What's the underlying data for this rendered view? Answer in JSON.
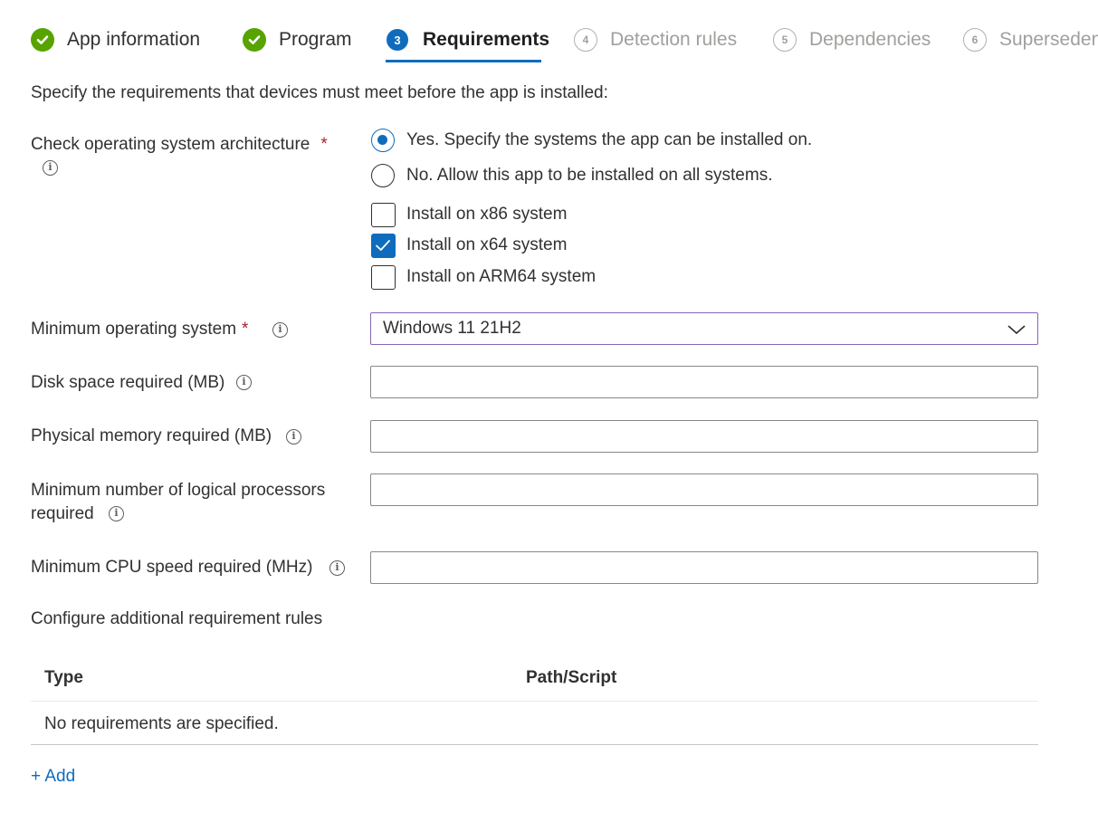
{
  "steps": [
    {
      "number": "",
      "label": "App information",
      "state": "done"
    },
    {
      "number": "",
      "label": "Program",
      "state": "done"
    },
    {
      "number": "3",
      "label": "Requirements",
      "state": "current"
    },
    {
      "number": "4",
      "label": "Detection rules",
      "state": "pending"
    },
    {
      "number": "5",
      "label": "Dependencies",
      "state": "pending"
    },
    {
      "number": "6",
      "label": "Superseden",
      "state": "pending"
    }
  ],
  "intro": "Specify the requirements that devices must meet before the app is installed:",
  "arch": {
    "label": "Check operating system architecture",
    "required_mark": "*",
    "options": [
      {
        "label": "Yes. Specify the systems the app can be installed on.",
        "selected": true
      },
      {
        "label": "No. Allow this app to be installed on all systems.",
        "selected": false
      }
    ],
    "systems": [
      {
        "label": "Install on x86 system",
        "checked": false
      },
      {
        "label": "Install on x64 system",
        "checked": true
      },
      {
        "label": "Install on ARM64 system",
        "checked": false
      }
    ]
  },
  "fields": {
    "min_os": {
      "label": "Minimum operating system",
      "required_mark": "*",
      "value": "Windows 11 21H2"
    },
    "disk": {
      "label": "Disk space required (MB)",
      "value": ""
    },
    "memory": {
      "label": "Physical memory required (MB)",
      "value": ""
    },
    "processors": {
      "label_line1": "Minimum number of logical processors",
      "label_line2": "required",
      "value": ""
    },
    "cpu": {
      "label": "Minimum CPU speed required (MHz)",
      "value": ""
    }
  },
  "additional": {
    "title": "Configure additional requirement rules",
    "columns": [
      "Type",
      "Path/Script"
    ],
    "empty_text": "No requirements are specified.",
    "add_label": "+ Add"
  },
  "icons": {
    "info": "info-icon",
    "check": "checkmark-icon",
    "dropdown": "chevron-down-icon"
  },
  "colors": {
    "accent": "#0f6cbd",
    "done": "#57a300",
    "required": "#a4262c",
    "select_border": "#8764b8"
  }
}
